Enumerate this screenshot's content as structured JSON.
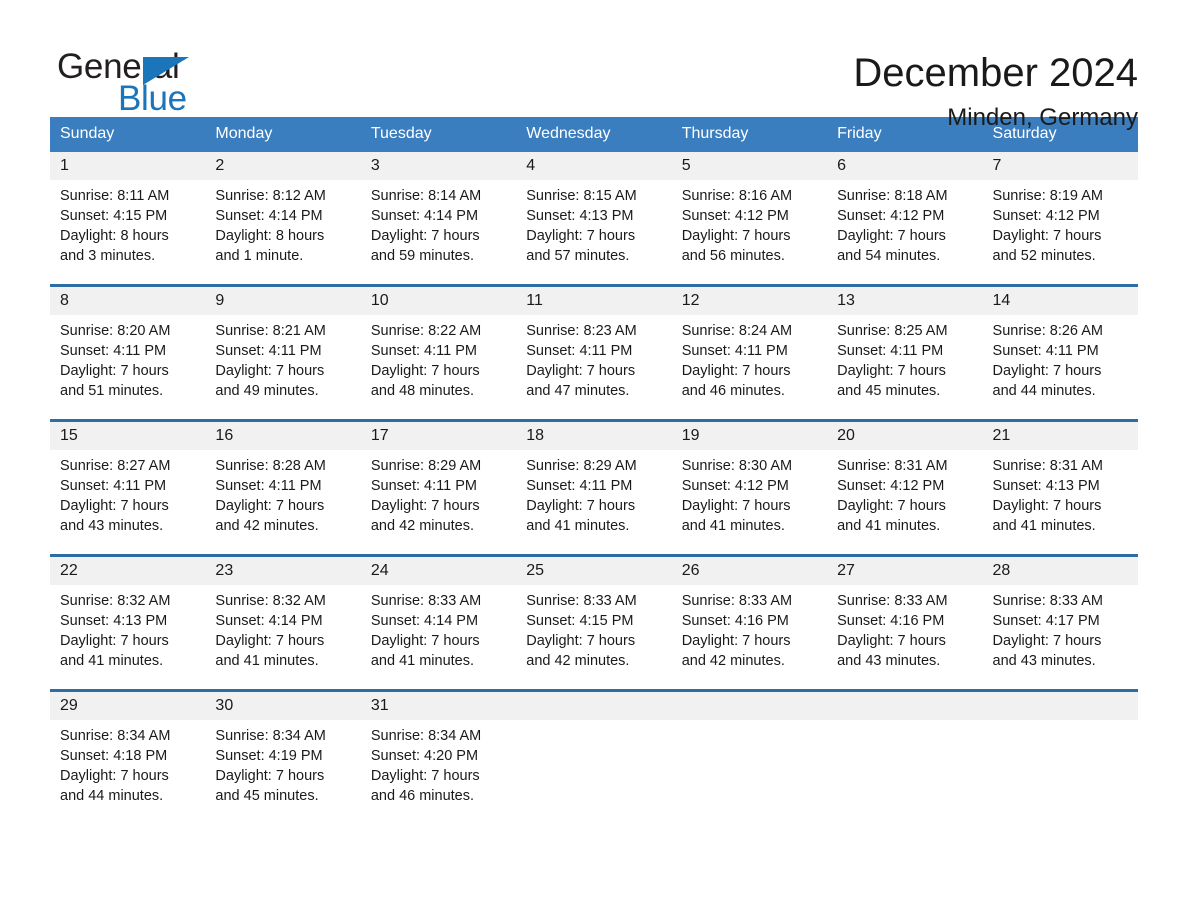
{
  "brand": {
    "name_part1": "General",
    "name_part2": "Blue",
    "flag_icon": "triangle-flag-icon"
  },
  "header": {
    "title": "December 2024",
    "location": "Minden, Germany"
  },
  "calendar": {
    "weekday_headers": [
      "Sunday",
      "Monday",
      "Tuesday",
      "Wednesday",
      "Thursday",
      "Friday",
      "Saturday"
    ],
    "colors": {
      "header_bg": "#3a7ebf",
      "header_text": "#ffffff",
      "row_divider": "#2e6da4",
      "daynum_bg": "#f1f1f1",
      "brand_blue": "#1b75bb",
      "text": "#1a1a1a"
    },
    "weeks": [
      [
        {
          "day": "1",
          "sunrise": "Sunrise: 8:11 AM",
          "sunset": "Sunset: 4:15 PM",
          "daylight_line1": "Daylight: 8 hours",
          "daylight_line2": "and 3 minutes."
        },
        {
          "day": "2",
          "sunrise": "Sunrise: 8:12 AM",
          "sunset": "Sunset: 4:14 PM",
          "daylight_line1": "Daylight: 8 hours",
          "daylight_line2": "and 1 minute."
        },
        {
          "day": "3",
          "sunrise": "Sunrise: 8:14 AM",
          "sunset": "Sunset: 4:14 PM",
          "daylight_line1": "Daylight: 7 hours",
          "daylight_line2": "and 59 minutes."
        },
        {
          "day": "4",
          "sunrise": "Sunrise: 8:15 AM",
          "sunset": "Sunset: 4:13 PM",
          "daylight_line1": "Daylight: 7 hours",
          "daylight_line2": "and 57 minutes."
        },
        {
          "day": "5",
          "sunrise": "Sunrise: 8:16 AM",
          "sunset": "Sunset: 4:12 PM",
          "daylight_line1": "Daylight: 7 hours",
          "daylight_line2": "and 56 minutes."
        },
        {
          "day": "6",
          "sunrise": "Sunrise: 8:18 AM",
          "sunset": "Sunset: 4:12 PM",
          "daylight_line1": "Daylight: 7 hours",
          "daylight_line2": "and 54 minutes."
        },
        {
          "day": "7",
          "sunrise": "Sunrise: 8:19 AM",
          "sunset": "Sunset: 4:12 PM",
          "daylight_line1": "Daylight: 7 hours",
          "daylight_line2": "and 52 minutes."
        }
      ],
      [
        {
          "day": "8",
          "sunrise": "Sunrise: 8:20 AM",
          "sunset": "Sunset: 4:11 PM",
          "daylight_line1": "Daylight: 7 hours",
          "daylight_line2": "and 51 minutes."
        },
        {
          "day": "9",
          "sunrise": "Sunrise: 8:21 AM",
          "sunset": "Sunset: 4:11 PM",
          "daylight_line1": "Daylight: 7 hours",
          "daylight_line2": "and 49 minutes."
        },
        {
          "day": "10",
          "sunrise": "Sunrise: 8:22 AM",
          "sunset": "Sunset: 4:11 PM",
          "daylight_line1": "Daylight: 7 hours",
          "daylight_line2": "and 48 minutes."
        },
        {
          "day": "11",
          "sunrise": "Sunrise: 8:23 AM",
          "sunset": "Sunset: 4:11 PM",
          "daylight_line1": "Daylight: 7 hours",
          "daylight_line2": "and 47 minutes."
        },
        {
          "day": "12",
          "sunrise": "Sunrise: 8:24 AM",
          "sunset": "Sunset: 4:11 PM",
          "daylight_line1": "Daylight: 7 hours",
          "daylight_line2": "and 46 minutes."
        },
        {
          "day": "13",
          "sunrise": "Sunrise: 8:25 AM",
          "sunset": "Sunset: 4:11 PM",
          "daylight_line1": "Daylight: 7 hours",
          "daylight_line2": "and 45 minutes."
        },
        {
          "day": "14",
          "sunrise": "Sunrise: 8:26 AM",
          "sunset": "Sunset: 4:11 PM",
          "daylight_line1": "Daylight: 7 hours",
          "daylight_line2": "and 44 minutes."
        }
      ],
      [
        {
          "day": "15",
          "sunrise": "Sunrise: 8:27 AM",
          "sunset": "Sunset: 4:11 PM",
          "daylight_line1": "Daylight: 7 hours",
          "daylight_line2": "and 43 minutes."
        },
        {
          "day": "16",
          "sunrise": "Sunrise: 8:28 AM",
          "sunset": "Sunset: 4:11 PM",
          "daylight_line1": "Daylight: 7 hours",
          "daylight_line2": "and 42 minutes."
        },
        {
          "day": "17",
          "sunrise": "Sunrise: 8:29 AM",
          "sunset": "Sunset: 4:11 PM",
          "daylight_line1": "Daylight: 7 hours",
          "daylight_line2": "and 42 minutes."
        },
        {
          "day": "18",
          "sunrise": "Sunrise: 8:29 AM",
          "sunset": "Sunset: 4:11 PM",
          "daylight_line1": "Daylight: 7 hours",
          "daylight_line2": "and 41 minutes."
        },
        {
          "day": "19",
          "sunrise": "Sunrise: 8:30 AM",
          "sunset": "Sunset: 4:12 PM",
          "daylight_line1": "Daylight: 7 hours",
          "daylight_line2": "and 41 minutes."
        },
        {
          "day": "20",
          "sunrise": "Sunrise: 8:31 AM",
          "sunset": "Sunset: 4:12 PM",
          "daylight_line1": "Daylight: 7 hours",
          "daylight_line2": "and 41 minutes."
        },
        {
          "day": "21",
          "sunrise": "Sunrise: 8:31 AM",
          "sunset": "Sunset: 4:13 PM",
          "daylight_line1": "Daylight: 7 hours",
          "daylight_line2": "and 41 minutes."
        }
      ],
      [
        {
          "day": "22",
          "sunrise": "Sunrise: 8:32 AM",
          "sunset": "Sunset: 4:13 PM",
          "daylight_line1": "Daylight: 7 hours",
          "daylight_line2": "and 41 minutes."
        },
        {
          "day": "23",
          "sunrise": "Sunrise: 8:32 AM",
          "sunset": "Sunset: 4:14 PM",
          "daylight_line1": "Daylight: 7 hours",
          "daylight_line2": "and 41 minutes."
        },
        {
          "day": "24",
          "sunrise": "Sunrise: 8:33 AM",
          "sunset": "Sunset: 4:14 PM",
          "daylight_line1": "Daylight: 7 hours",
          "daylight_line2": "and 41 minutes."
        },
        {
          "day": "25",
          "sunrise": "Sunrise: 8:33 AM",
          "sunset": "Sunset: 4:15 PM",
          "daylight_line1": "Daylight: 7 hours",
          "daylight_line2": "and 42 minutes."
        },
        {
          "day": "26",
          "sunrise": "Sunrise: 8:33 AM",
          "sunset": "Sunset: 4:16 PM",
          "daylight_line1": "Daylight: 7 hours",
          "daylight_line2": "and 42 minutes."
        },
        {
          "day": "27",
          "sunrise": "Sunrise: 8:33 AM",
          "sunset": "Sunset: 4:16 PM",
          "daylight_line1": "Daylight: 7 hours",
          "daylight_line2": "and 43 minutes."
        },
        {
          "day": "28",
          "sunrise": "Sunrise: 8:33 AM",
          "sunset": "Sunset: 4:17 PM",
          "daylight_line1": "Daylight: 7 hours",
          "daylight_line2": "and 43 minutes."
        }
      ],
      [
        {
          "day": "29",
          "sunrise": "Sunrise: 8:34 AM",
          "sunset": "Sunset: 4:18 PM",
          "daylight_line1": "Daylight: 7 hours",
          "daylight_line2": "and 44 minutes."
        },
        {
          "day": "30",
          "sunrise": "Sunrise: 8:34 AM",
          "sunset": "Sunset: 4:19 PM",
          "daylight_line1": "Daylight: 7 hours",
          "daylight_line2": "and 45 minutes."
        },
        {
          "day": "31",
          "sunrise": "Sunrise: 8:34 AM",
          "sunset": "Sunset: 4:20 PM",
          "daylight_line1": "Daylight: 7 hours",
          "daylight_line2": "and 46 minutes."
        },
        {
          "day": "",
          "sunrise": "",
          "sunset": "",
          "daylight_line1": "",
          "daylight_line2": ""
        },
        {
          "day": "",
          "sunrise": "",
          "sunset": "",
          "daylight_line1": "",
          "daylight_line2": ""
        },
        {
          "day": "",
          "sunrise": "",
          "sunset": "",
          "daylight_line1": "",
          "daylight_line2": ""
        },
        {
          "day": "",
          "sunrise": "",
          "sunset": "",
          "daylight_line1": "",
          "daylight_line2": ""
        }
      ]
    ]
  }
}
